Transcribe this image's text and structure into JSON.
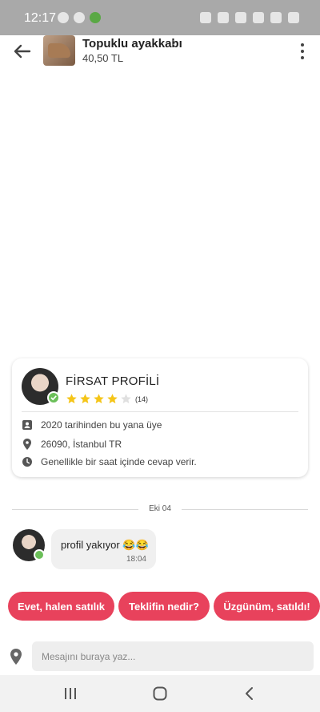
{
  "status_bar": {
    "time": "12:17"
  },
  "header": {
    "product_title": "Topuklu ayakkabı",
    "product_price": "40,50 TL",
    "chevron": "›"
  },
  "seller": {
    "name": "FİRSAT PROFİLİ",
    "rating": 4,
    "rating_max": 5,
    "review_count": "(14)",
    "member_since": "2020 tarihinden bu yana üye",
    "location": "26090, İstanbul TR",
    "response_time": "Genellikle bir saat içinde cevap verir."
  },
  "chat": {
    "date_separator": "Eki 04",
    "messages": [
      {
        "text": "profil yakıyor 😂😂",
        "time": "18:04"
      }
    ]
  },
  "quick_replies": [
    "Evet, halen satılık",
    "Teklifin nedir?",
    "Üzgünüm, satıldı!"
  ],
  "composer": {
    "placeholder": "Mesajını buraya yaz..."
  },
  "colors": {
    "accent": "#e8425c",
    "verified": "#6bbf59",
    "star_filled": "#f5c518",
    "star_empty": "#e0e0e0"
  },
  "icons": {
    "back": "arrow-left-icon",
    "more": "more-vertical-icon",
    "member": "id-card-icon",
    "location": "map-pin-icon",
    "clock": "clock-icon",
    "attach_location": "map-pin-icon"
  }
}
